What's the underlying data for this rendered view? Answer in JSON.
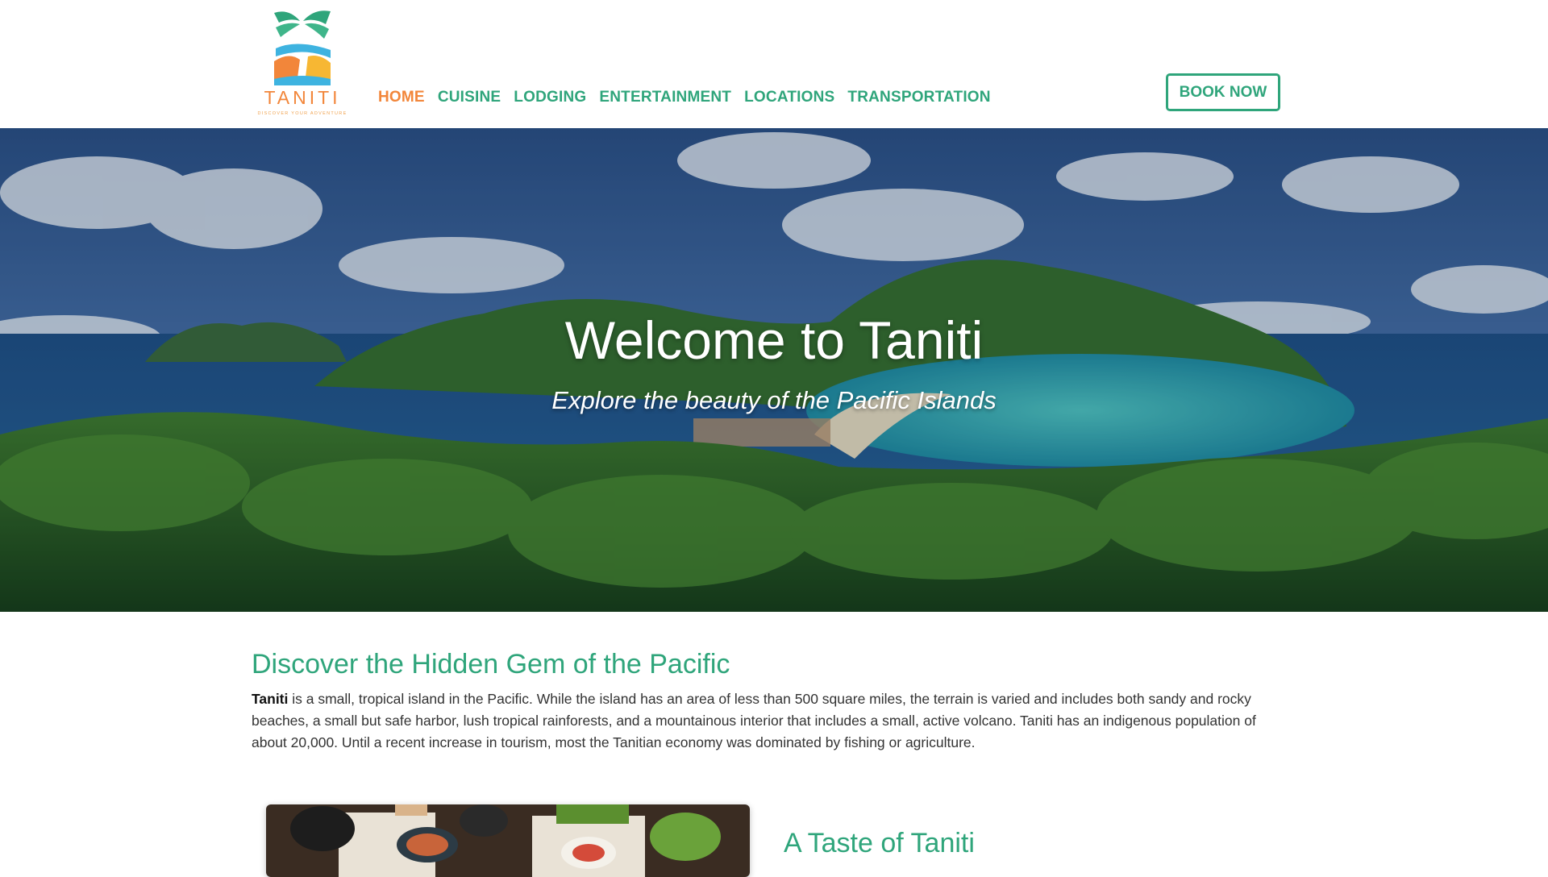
{
  "brand": {
    "name": "TANITI",
    "tagline": "DISCOVER YOUR ADVENTURE"
  },
  "nav": {
    "items": [
      {
        "label": "HOME",
        "active": true
      },
      {
        "label": "CUISINE",
        "active": false
      },
      {
        "label": "LODGING",
        "active": false
      },
      {
        "label": "ENTERTAINMENT",
        "active": false
      },
      {
        "label": "LOCATIONS",
        "active": false
      },
      {
        "label": "TRANSPORTATION",
        "active": false
      }
    ],
    "book_label": "BOOK NOW"
  },
  "hero": {
    "title": "Welcome to Taniti",
    "subtitle": "Explore the beauty of the Pacific Islands"
  },
  "intro": {
    "heading": "Discover the Hidden Gem of the Pacific",
    "lead": "Taniti",
    "body": " is a small, tropical island in the Pacific. While the island has an area of less than 500 square miles, the terrain is varied and includes both sandy and rocky beaches, a small but safe harbor, lush tropical rainforests, and a mountainous interior that includes a small, active volcano. Taniti has an indigenous population of about 20,000. Until a recent increase in tourism, most the Tanitian economy was dominated by fishing or agriculture."
  },
  "taste": {
    "heading": "A Taste of Taniti"
  },
  "colors": {
    "accent_green": "#2fa57b",
    "accent_orange": "#f2863a",
    "text": "#333333"
  }
}
